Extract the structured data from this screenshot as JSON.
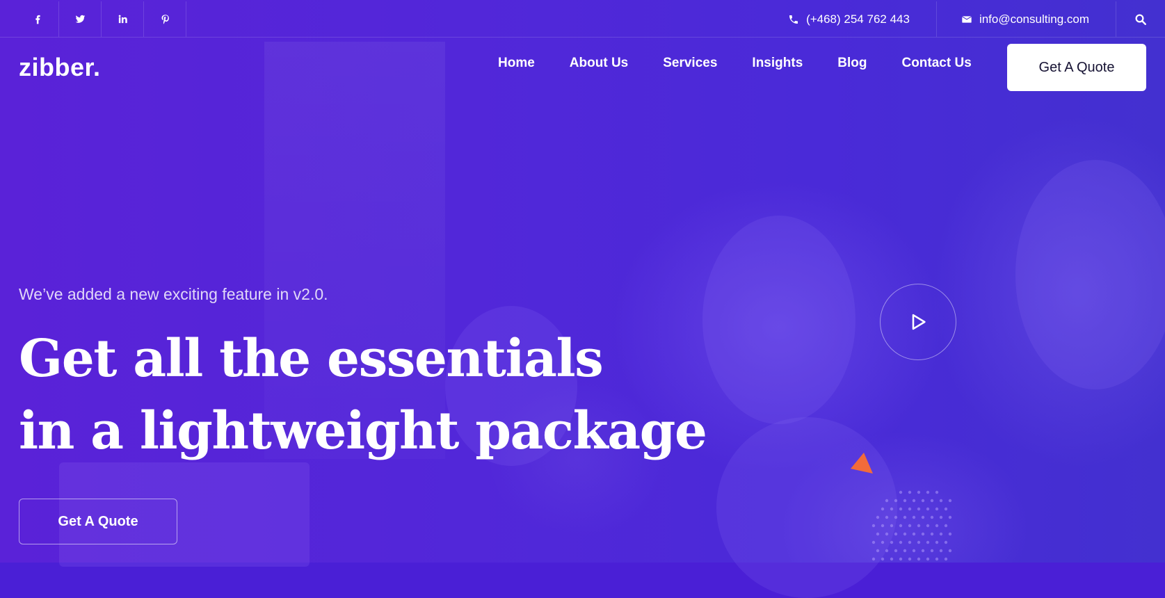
{
  "topbar": {
    "social": [
      {
        "icon": "facebook-icon"
      },
      {
        "icon": "twitter-icon"
      },
      {
        "icon": "linkedin-icon"
      },
      {
        "icon": "pinterest-icon"
      }
    ],
    "phone": "(+468) 254 762 443",
    "email": "info@consulting.com"
  },
  "nav": {
    "logo": "zibber.",
    "links": [
      "Home",
      "About Us",
      "Services",
      "Insights",
      "Blog",
      "Contact Us"
    ],
    "cta": "Get A Quote"
  },
  "hero": {
    "subtitle": "We’ve added a new exciting feature in v2.0.",
    "headline_line1": "Get all the essentials",
    "headline_line2": "in a lightweight package",
    "cta": "Get A Quote"
  },
  "colors": {
    "background": "#4a1fd6",
    "accent": "#f26b3a",
    "button_text": "#161233"
  }
}
